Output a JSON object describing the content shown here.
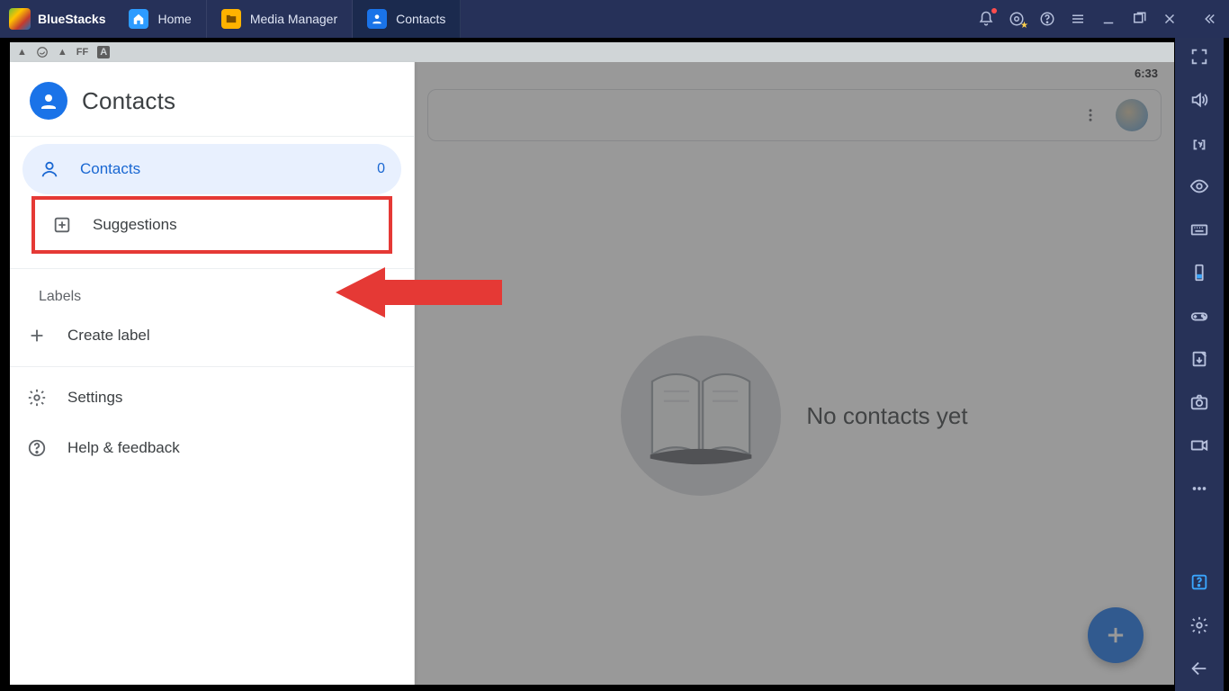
{
  "titlebar": {
    "brand": "BlueStacks",
    "tabs": [
      {
        "label": "Home",
        "icon": "home"
      },
      {
        "label": "Media Manager",
        "icon": "folder"
      },
      {
        "label": "Contacts",
        "icon": "person",
        "active": true
      }
    ]
  },
  "android_status": {
    "time": "6:33"
  },
  "drawer": {
    "title": "Contacts",
    "contacts": {
      "label": "Contacts",
      "count": "0"
    },
    "suggestions": {
      "label": "Suggestions"
    },
    "labels_header": "Labels",
    "create_label": "Create label",
    "settings": "Settings",
    "help": "Help & feedback"
  },
  "main": {
    "empty_text": "No contacts yet"
  },
  "right_rail_icons": [
    "fullscreen",
    "volume",
    "target",
    "eye",
    "keyboard",
    "phone",
    "gamepad",
    "clipboard",
    "camera",
    "record",
    "more",
    "q",
    "gear",
    "back"
  ]
}
